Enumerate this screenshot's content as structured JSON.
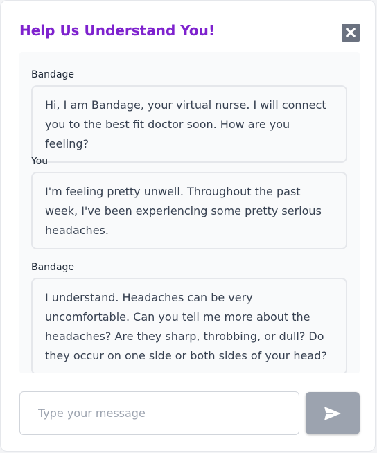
{
  "modal": {
    "title": "Help Us Understand You!",
    "title_color": "#7e22ce"
  },
  "close_button": {
    "icon": "close-icon",
    "color": "#6b7280"
  },
  "messages": [
    {
      "sender": "Bandage",
      "text": "Hi, I am Bandage, your virtual nurse. I will connect you to the best fit doctor soon. How are you feeling?"
    },
    {
      "sender": "You",
      "text": "I'm feeling pretty unwell. Throughout the past week, I've been experiencing some pretty serious headaches."
    },
    {
      "sender": "Bandage",
      "text": "I understand. Headaches can be very uncomfortable. Can you tell me more about the headaches? Are they sharp, throbbing, or dull? Do they occur on one side or both sides of your head?"
    }
  ],
  "composer": {
    "placeholder": "Type your message",
    "value": "",
    "send_icon": "send-icon",
    "send_button_color": "#9ca3af"
  }
}
